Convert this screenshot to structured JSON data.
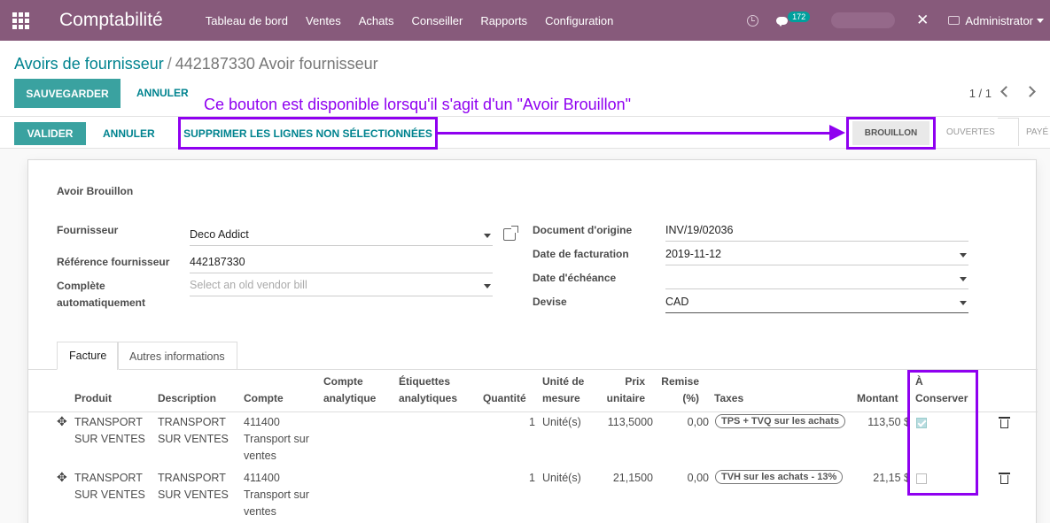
{
  "navbar": {
    "app_title": "Comptabilité",
    "menu": [
      "Tableau de bord",
      "Ventes",
      "Achats",
      "Conseiller",
      "Rapports",
      "Configuration"
    ],
    "chat_count": "172",
    "user": "Administrator"
  },
  "breadcrumb": {
    "parent": "Avoirs de fournisseur",
    "separator": "/",
    "current": "442187330 Avoir fournisseur"
  },
  "buttons": {
    "save": "SAUVEGARDER",
    "discard": "ANNULER",
    "validate": "VALIDER",
    "cancel": "ANNULER",
    "delete_unselected": "SUPPRIMER LES LIGNES NON SÉLECTIONNÉES"
  },
  "pager": "1 / 1",
  "annotation": "Ce bouton est disponible lorsqu'il s'agit d'un \"Avoir Brouillon\"",
  "annotation_color": "#8f00f0",
  "statusbar": {
    "stages": [
      "BROUILLON",
      "OUVERTES",
      "PAYÉ"
    ],
    "active": "BROUILLON"
  },
  "form": {
    "title": "Avoir Brouillon",
    "left": {
      "vendor_label": "Fournisseur",
      "vendor_value": "Deco Addict",
      "vendor_ref_label": "Référence fournisseur",
      "vendor_ref_value": "442187330",
      "autocomplete_label": "Complète automatiquement",
      "autocomplete_placeholder": "Select an old vendor bill"
    },
    "right": {
      "origin_label": "Document d'origine",
      "origin_value": "INV/19/02036",
      "invoice_date_label": "Date de facturation",
      "invoice_date_value": "2019-11-12",
      "due_date_label": "Date d'échéance",
      "due_date_value": "",
      "currency_label": "Devise",
      "currency_value": "CAD"
    }
  },
  "tabs": [
    "Facture",
    "Autres informations"
  ],
  "table": {
    "headers": {
      "product": "Produit",
      "description": "Description",
      "account": "Compte",
      "analytic_account": "Compte analytique",
      "analytic_tags": "Étiquettes analytiques",
      "quantity": "Quantité",
      "uom": "Unité de mesure",
      "unit_price": "Prix unitaire",
      "discount": "Remise (%)",
      "taxes": "Taxes",
      "amount": "Montant",
      "keep": "À Conserver"
    },
    "rows": [
      {
        "product": "TRANSPORT SUR VENTES",
        "description": "TRANSPORT SUR VENTES",
        "account": "411400 Transport sur ventes",
        "quantity": "1",
        "uom": "Unité(s)",
        "unit_price": "113,5000",
        "discount": "0,00",
        "tax": "TPS + TVQ sur les achats",
        "amount": "113,50 $",
        "keep": true
      },
      {
        "product": "TRANSPORT SUR VENTES",
        "description": "TRANSPORT SUR VENTES",
        "account": "411400 Transport sur ventes",
        "quantity": "1",
        "uom": "Unité(s)",
        "unit_price": "21,1500",
        "discount": "0,00",
        "tax": "TVH sur les achats - 13%",
        "amount": "21,15 $",
        "keep": false
      }
    ]
  }
}
